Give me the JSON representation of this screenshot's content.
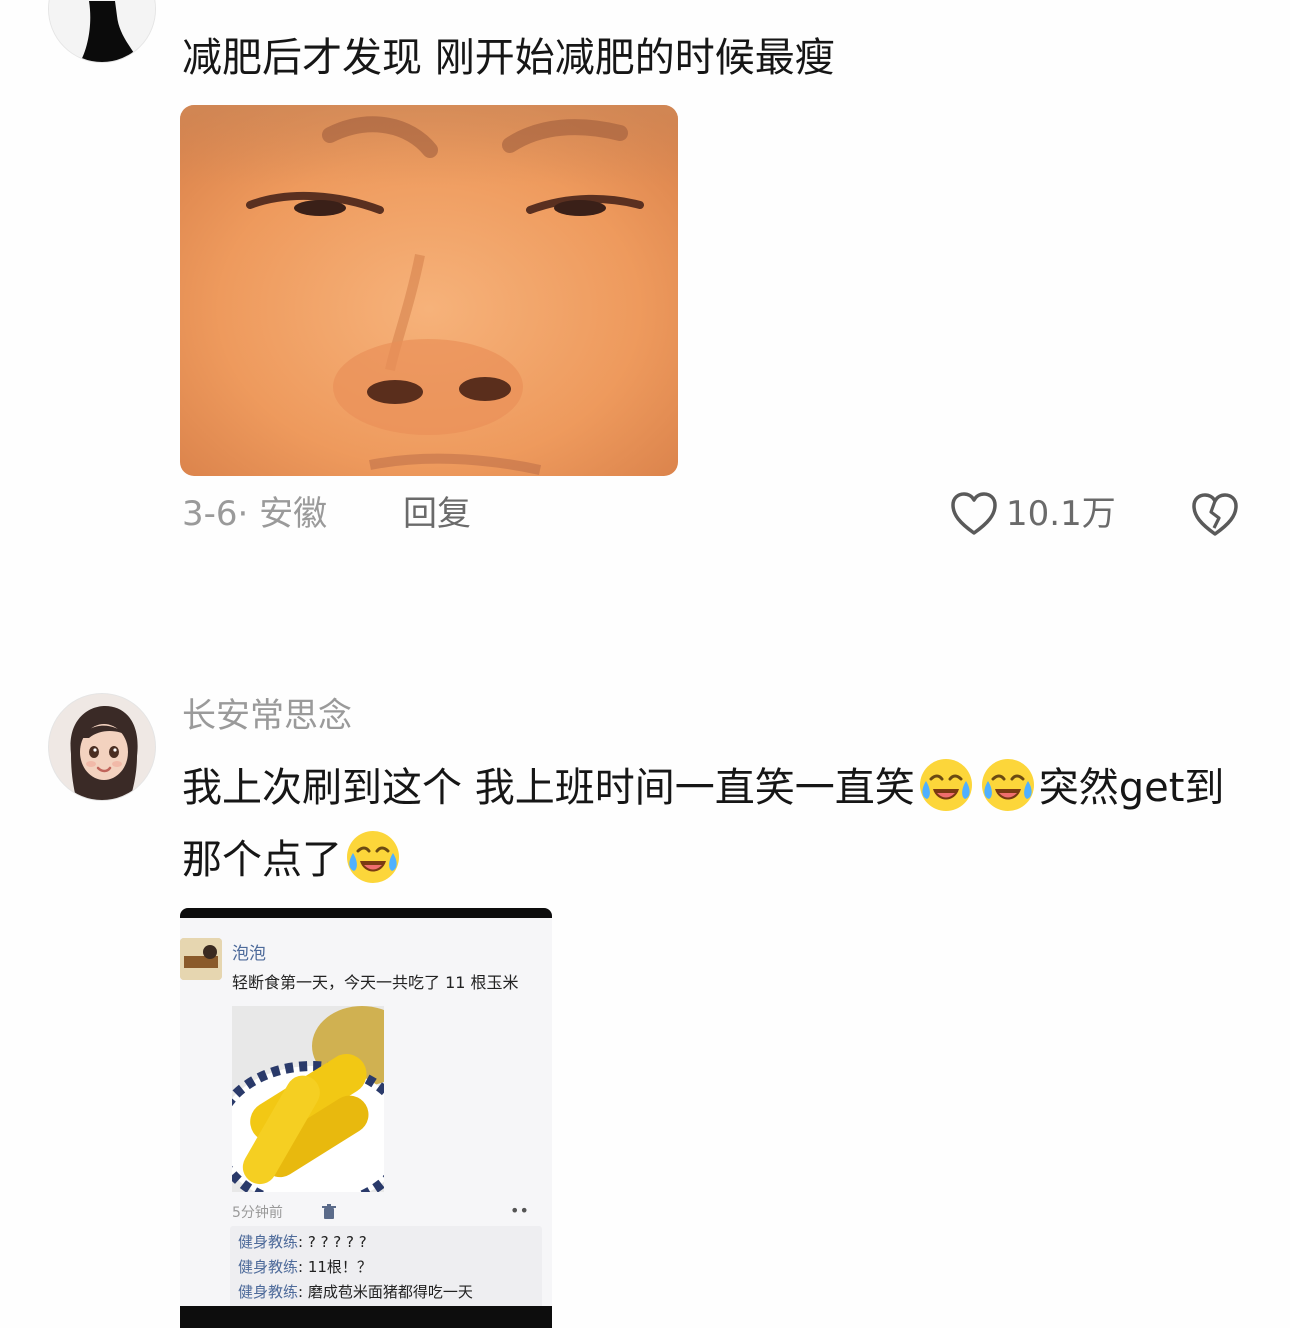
{
  "comments": [
    {
      "text": "减肥后才发现 刚开始减肥的时候最瘦",
      "date_location": "3-6· 安徽",
      "reply_label": "回复",
      "like_count": "10.1万"
    },
    {
      "username": "长安常思念",
      "text_parts": [
        "我上次刷到这个 我上班时间一直笑一直笑",
        "突然get到那个点了"
      ],
      "emoji": "crying-laughing-emoji"
    }
  ],
  "embedded_screenshot": {
    "poster_name": "泡泡",
    "post_text": "轻断食第一天，今天一共吃了 11 根玉米",
    "time": "5分钟前",
    "more_label": "••",
    "comments": [
      {
        "who": "健身教练",
        "text": ": ? ? ? ? ?"
      },
      {
        "who": "健身教练",
        "text": ": 11根！？"
      },
      {
        "who": "健身教练",
        "text": ": 磨成苞米面猪都得吃一天"
      }
    ]
  },
  "colors": {
    "text": "#161616",
    "meta": "#9a9a9a",
    "action": "#6a6a6a",
    "link": "#4d6a9a"
  }
}
